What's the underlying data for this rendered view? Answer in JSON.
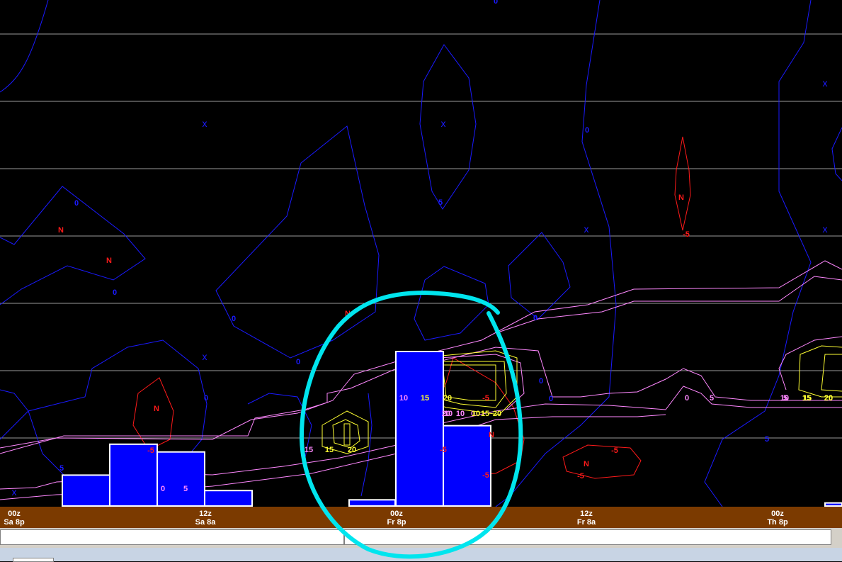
{
  "chart_data": {
    "type": "meteogram",
    "time_axis": [
      {
        "line1": "00z",
        "line2": "Sa 8p"
      },
      {
        "line1": "12z",
        "line2": "Sa 8a"
      },
      {
        "line1": "00z",
        "line2": "Fr 8p"
      },
      {
        "line1": "12z",
        "line2": "Fr 8a"
      },
      {
        "line1": "00z",
        "line2": "Th 8p"
      }
    ],
    "contour_labels": {
      "blue": [
        "0",
        "0",
        "0",
        "0",
        "0",
        "0",
        "0",
        "0",
        "0",
        "0",
        "0",
        "5",
        "5",
        "5",
        "5"
      ],
      "red": [
        "N",
        "N",
        "N",
        "N",
        "N",
        "N",
        "N",
        "-5",
        "-5",
        "-5",
        "-5",
        "-5",
        "-5",
        "-5"
      ],
      "violet": [
        "0",
        "5",
        "10",
        "15",
        "20",
        "10",
        "0",
        "5",
        "10",
        "5",
        "0",
        "10"
      ],
      "yellow": [
        "15",
        "20",
        "15",
        "20",
        "15",
        "20",
        "15",
        "20",
        "10",
        "15",
        "20"
      ]
    },
    "x_markers": [
      "x",
      "x",
      "x",
      "x",
      "x",
      "x",
      "x"
    ],
    "precip_bar_values": [
      0.2,
      0.4,
      0.35,
      0.1,
      0.04,
      1.0,
      0.52,
      0.02
    ],
    "colors": {
      "background": "#000000",
      "blue_contour": "#1a1aff",
      "red_contour": "#ff1a1a",
      "violet_contour": "#ff88ff",
      "yellow_contour": "#ffff33",
      "bars": "#0000ff",
      "time_bar": "#7b3a00",
      "annotation": "#00e5ee"
    }
  }
}
